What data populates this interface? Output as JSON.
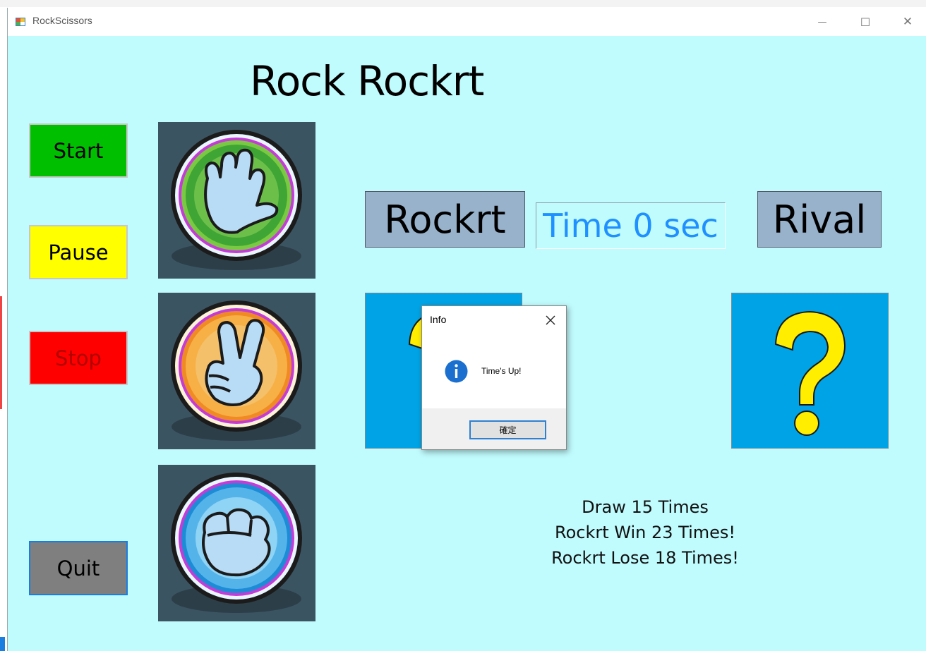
{
  "window": {
    "title": "RockScissors",
    "minimize_glyph": "—",
    "maximize_glyph": "☐",
    "close_glyph": "✕"
  },
  "app": {
    "heading": "Rock Rockrt",
    "buttons": {
      "start": "Start",
      "pause": "Pause",
      "stop": "Stop",
      "quit": "Quit"
    },
    "button_colors": {
      "start": "#00bf00",
      "pause": "#ffff00",
      "stop": "#ff0000",
      "quit": "#7f7f7f"
    },
    "hands": [
      "paper-hand-icon",
      "scissors-hand-icon",
      "rock-hand-icon"
    ],
    "player_label": "Rockrt",
    "timer_text": "Time 0 sec",
    "rival_label": "Rival",
    "stats": {
      "draw": "Draw 15 Times",
      "win": "Rockrt Win 23 Times!",
      "lose": "Rockrt Lose 18 Times!"
    }
  },
  "dialog": {
    "title": "Info",
    "message": "Time's Up!",
    "ok_label": "確定"
  },
  "colors": {
    "client_bg": "#c0fbfd",
    "label_box_bg": "#98b2cc",
    "timer_text": "#1e90ff",
    "picture_bg": "#00a4e6",
    "question_mark": "#ffee00"
  }
}
